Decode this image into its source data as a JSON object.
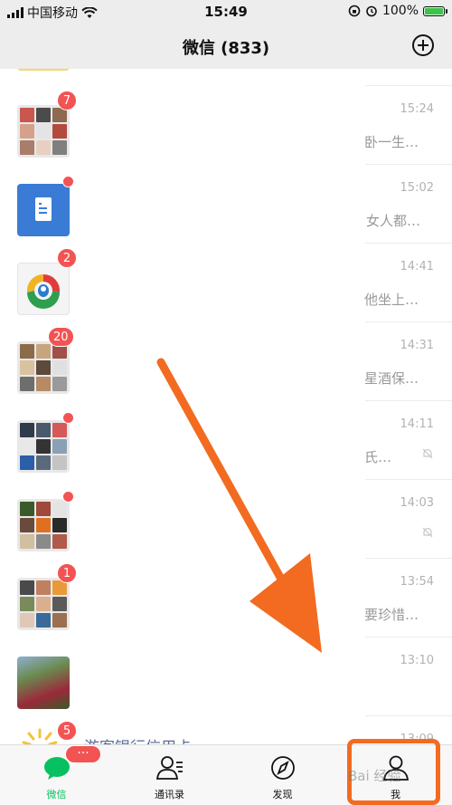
{
  "status_bar": {
    "carrier": "中国移动",
    "time": "15:49",
    "battery": "100%"
  },
  "nav": {
    "title": "微信 (833)"
  },
  "chats": [
    {
      "time": "15:24",
      "preview": "卧一生…",
      "badge": "7"
    },
    {
      "time": "15:02",
      "preview": "女人都…",
      "badge": ""
    },
    {
      "time": "14:41",
      "preview": "他坐上…",
      "badge": "2"
    },
    {
      "time": "14:31",
      "preview": "星酒保…",
      "badge": "20"
    },
    {
      "time": "14:11",
      "preview": "氏…",
      "badge": ""
    },
    {
      "time": "14:03",
      "preview": "",
      "badge": ""
    },
    {
      "time": "13:54",
      "preview": "要珍惜…",
      "badge": "1"
    },
    {
      "time": "13:10",
      "preview": "",
      "badge": ""
    },
    {
      "time": "13:09",
      "preview": "",
      "badge": "5",
      "name_partial": "游客银行信用卡"
    }
  ],
  "tabbar": {
    "chats_label": "微信",
    "chats_badge": "···",
    "contacts_label": "通讯录",
    "discover_label": "发现",
    "me_label": "我"
  },
  "watermark": "Bai 经验",
  "colors": {
    "accent_green": "#07c160",
    "badge_red": "#f35353",
    "annotation_orange": "#f26b21"
  }
}
